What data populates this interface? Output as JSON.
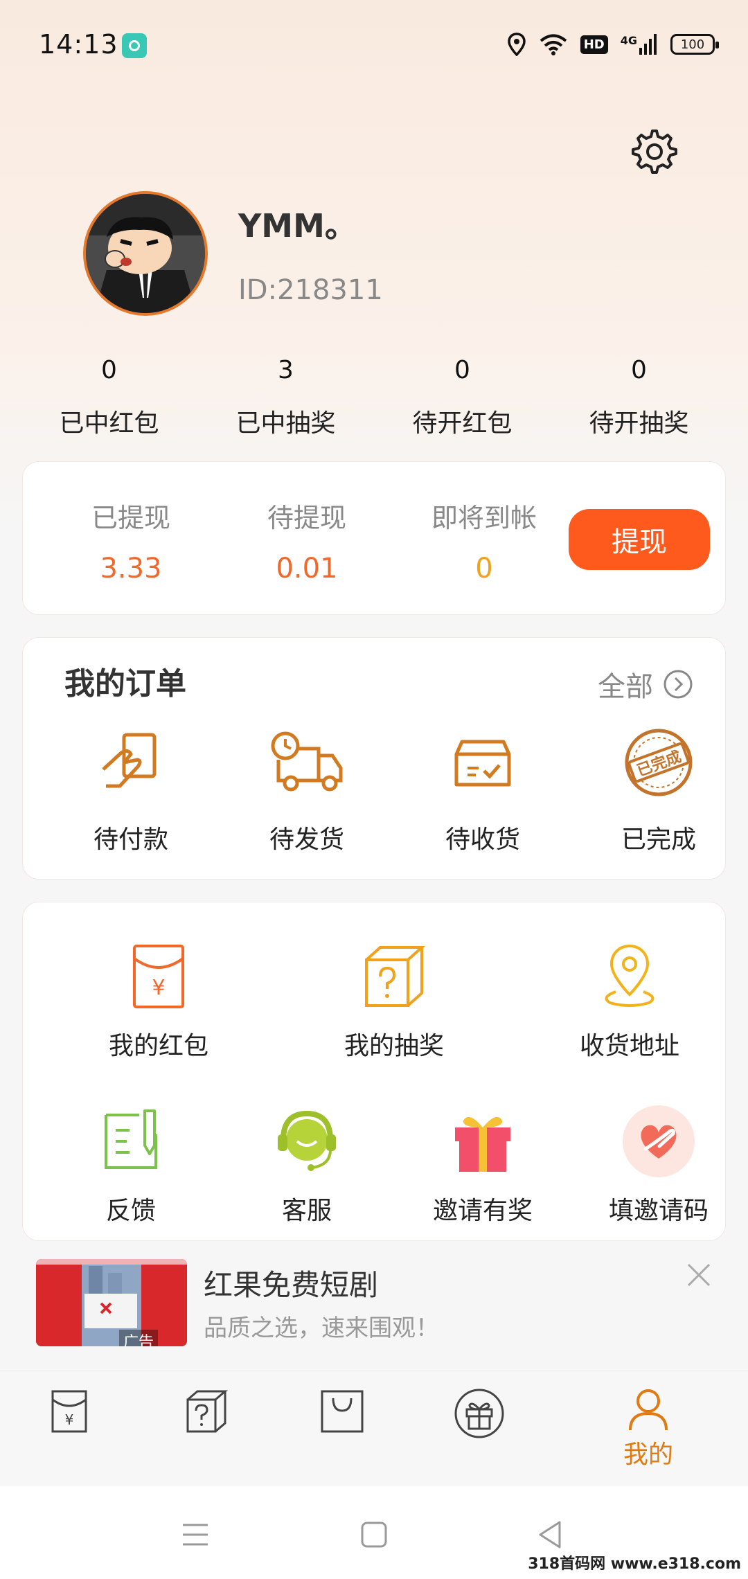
{
  "status_bar": {
    "time": "14:13",
    "hd": "HD",
    "network": "4G",
    "battery": "100"
  },
  "profile": {
    "username": "YMM。",
    "user_id": "ID:218311"
  },
  "stats": [
    {
      "value": "0",
      "label": "已中红包"
    },
    {
      "value": "3",
      "label": "已中抽奖"
    },
    {
      "value": "0",
      "label": "待开红包"
    },
    {
      "value": "0",
      "label": "待开抽奖"
    }
  ],
  "withdraw": {
    "items": [
      {
        "label": "已提现",
        "value": "3.33",
        "color": "#f2682a"
      },
      {
        "label": "待提现",
        "value": "0.01",
        "color": "#f2682a"
      },
      {
        "label": "即将到帐",
        "value": "0",
        "color": "#f2a21a"
      }
    ],
    "button": "提现"
  },
  "orders": {
    "title": "我的订单",
    "all_label": "全部",
    "items": [
      {
        "label": "待付款",
        "icon": "payment-icon"
      },
      {
        "label": "待发货",
        "icon": "delivery-truck-icon"
      },
      {
        "label": "待收货",
        "icon": "receive-box-icon"
      },
      {
        "label": "已完成",
        "icon": "completed-stamp-icon",
        "stamp": "已完成"
      }
    ]
  },
  "tools": [
    {
      "label": "我的红包",
      "icon": "red-envelope-icon",
      "color": "#f2682a"
    },
    {
      "label": "我的抽奖",
      "icon": "lottery-box-icon",
      "color": "#f2a21a"
    },
    {
      "label": "收货地址",
      "icon": "location-pin-icon",
      "color": "#f2b21a"
    },
    {
      "label": "反馈",
      "icon": "feedback-icon",
      "color": "#7cc24a"
    },
    {
      "label": "客服",
      "icon": "headset-icon",
      "color": "#a6c936"
    },
    {
      "label": "邀请有奖",
      "icon": "gift-icon",
      "color": "#f2506a"
    },
    {
      "label": "填邀请码",
      "icon": "heart-hand-icon",
      "color": "#f26a5a"
    }
  ],
  "ad": {
    "title": "红果免费短剧",
    "subtitle": "品质之选，速来围观！",
    "tag": "广告"
  },
  "tabbar": {
    "items": [
      {
        "icon": "red-envelope-tab-icon"
      },
      {
        "icon": "lottery-tab-icon"
      },
      {
        "icon": "shopping-bag-tab-icon"
      },
      {
        "icon": "gift-tab-icon"
      },
      {
        "icon": "profile-tab-icon",
        "label": "我的",
        "active": true
      }
    ],
    "active_color": "#e07a12"
  },
  "watermark": "318首码网 www.e318.com"
}
